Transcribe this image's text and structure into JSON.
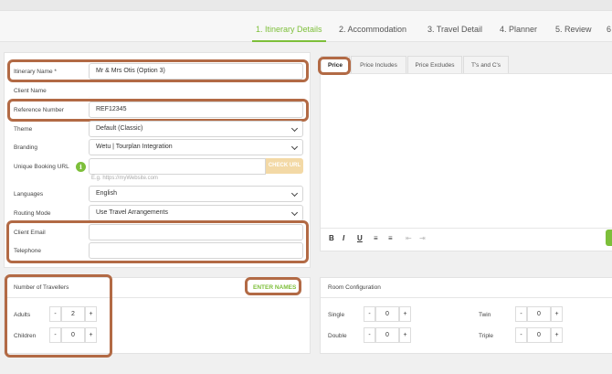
{
  "steps": [
    {
      "label": "1. Itinerary Details"
    },
    {
      "label": "2. Accommodation"
    },
    {
      "label": "3. Travel Detail"
    },
    {
      "label": "4. Planner"
    },
    {
      "label": "5. Review"
    },
    {
      "label": "6"
    }
  ],
  "form": {
    "itinerary_name": {
      "label": "Itinerary Name *",
      "value": "Mr & Mrs Otis (Option 3)"
    },
    "client_name": {
      "label": "Client Name",
      "value": ""
    },
    "reference_number": {
      "label": "Reference Number",
      "value": "REF12345"
    },
    "theme": {
      "label": "Theme",
      "value": "Default (Classic)"
    },
    "branding": {
      "label": "Branding",
      "value": "Wetu | Tourplan Integration"
    },
    "unique_booking_url": {
      "label": "Unique Booking URL",
      "value": "",
      "hint": "E.g. https://myWebsite.com",
      "check_button": "CHECK URL"
    },
    "languages": {
      "label": "Languages",
      "value": "English"
    },
    "routing_mode": {
      "label": "Routing Mode",
      "value": "Use Travel Arrangements"
    },
    "client_email": {
      "label": "Client Email",
      "value": ""
    },
    "telephone": {
      "label": "Telephone",
      "value": ""
    }
  },
  "price_tabs": [
    {
      "label": "Price"
    },
    {
      "label": "Price Includes"
    },
    {
      "label": "Price Excludes"
    },
    {
      "label": "T's and C's"
    }
  ],
  "toolbar": {
    "bold": "B",
    "italic": "I",
    "underline": "U",
    "ordered_list": "≡",
    "bullet_list": "≡",
    "outdent": "⇤",
    "indent": "⇥"
  },
  "travellers": {
    "title": "Number of Travellers",
    "enter_names": "ENTER NAMES",
    "adults": {
      "label": "Adults",
      "value": "2"
    },
    "children": {
      "label": "Children",
      "value": "0"
    }
  },
  "rooms": {
    "title": "Room Configuration",
    "single": {
      "label": "Single",
      "value": "0"
    },
    "twin": {
      "label": "Twin",
      "value": "0"
    },
    "double": {
      "label": "Double",
      "value": "0"
    },
    "triple": {
      "label": "Triple",
      "value": "0"
    }
  },
  "stepper": {
    "minus": "-",
    "plus": "+"
  },
  "icons": {
    "info": "i"
  },
  "colors": {
    "accent": "#7dbf3a",
    "highlight": "#b26a45",
    "check_url_bg": "#f3d9a6"
  }
}
